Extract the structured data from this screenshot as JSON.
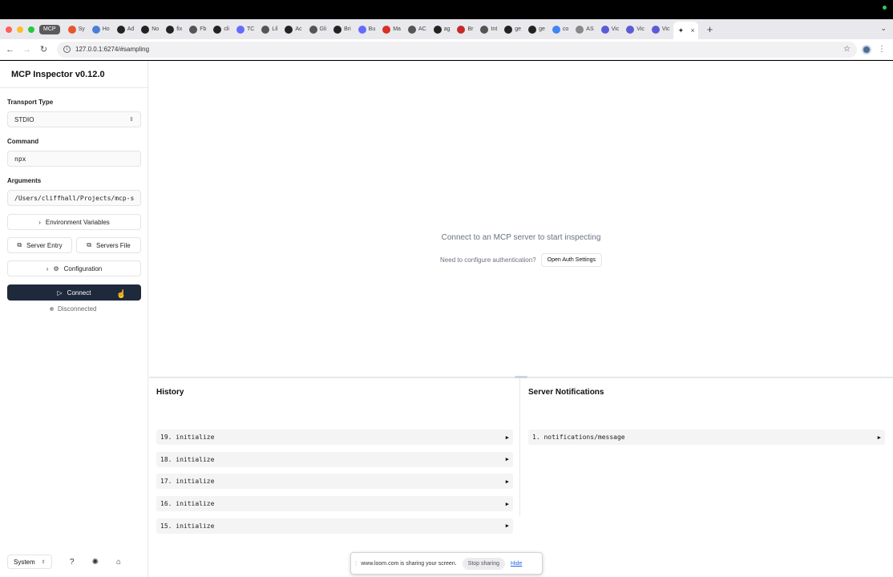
{
  "browser": {
    "pinned_tab": "MCP",
    "tabs": [
      {
        "label": "Sy",
        "icon": "sync-icon",
        "color": "#e4572e"
      },
      {
        "label": "Ho",
        "icon": "home-icon",
        "color": "#4a7fd6"
      },
      {
        "label": "Ad",
        "icon": "github-icon",
        "color": "#222222"
      },
      {
        "label": "No",
        "icon": "github-icon",
        "color": "#222222"
      },
      {
        "label": "fix",
        "icon": "github-icon",
        "color": "#222222"
      },
      {
        "label": "Fb",
        "icon": "file-icon",
        "color": "#555555"
      },
      {
        "label": "cli",
        "icon": "github-icon",
        "color": "#222222"
      },
      {
        "label": "TC",
        "icon": "vite-icon",
        "color": "#646cff"
      },
      {
        "label": "Lil",
        "icon": "lil-icon",
        "color": "#555555"
      },
      {
        "label": "Ac",
        "icon": "github-icon",
        "color": "#222222"
      },
      {
        "label": "Gli",
        "icon": "doc-icon",
        "color": "#555555"
      },
      {
        "label": "Bri",
        "icon": "github-icon",
        "color": "#222222"
      },
      {
        "label": "Bu",
        "icon": "vite-icon",
        "color": "#646cff"
      },
      {
        "label": "Ma",
        "icon": "gmail-icon",
        "color": "#d93025"
      },
      {
        "label": "AC",
        "icon": "chrome-icon",
        "color": "#555555"
      },
      {
        "label": "ag",
        "icon": "github-icon",
        "color": "#222222"
      },
      {
        "label": "Br",
        "icon": "red-icon",
        "color": "#c62828"
      },
      {
        "label": "Int",
        "icon": "pin-icon",
        "color": "#555555"
      },
      {
        "label": "ge",
        "icon": "github-icon",
        "color": "#222222"
      },
      {
        "label": "ge",
        "icon": "github-icon",
        "color": "#222222"
      },
      {
        "label": "co",
        "icon": "google-icon",
        "color": "#4285f4"
      },
      {
        "label": "AS",
        "icon": "gear-icon",
        "color": "#888888"
      },
      {
        "label": "Vic",
        "icon": "react-icon",
        "color": "#5b5bd6"
      },
      {
        "label": "Vic",
        "icon": "react-icon",
        "color": "#5b5bd6"
      },
      {
        "label": "Vic",
        "icon": "react-icon",
        "color": "#5b5bd6"
      }
    ],
    "url": "127.0.0.1:6274/#sampling"
  },
  "sidebar": {
    "title": "MCP Inspector v0.12.0",
    "transport_label": "Transport Type",
    "transport_value": "STDIO",
    "command_label": "Command",
    "command_value": "npx",
    "arguments_label": "Arguments",
    "arguments_value": "/Users/cliffhall/Projects/mcp-s",
    "env_button": "Environment Variables",
    "server_entry_button": "Server Entry",
    "servers_file_button": "Servers File",
    "config_button": "Configuration",
    "connect_button": "Connect",
    "status": "Disconnected",
    "theme": "System"
  },
  "main": {
    "empty_title": "Connect to an MCP server to start inspecting",
    "auth_prompt": "Need to configure authentication?",
    "auth_button": "Open Auth Settings"
  },
  "history": {
    "title": "History",
    "items": [
      "19. initialize",
      "18. initialize",
      "17. initialize",
      "16. initialize",
      "15. initialize"
    ]
  },
  "notifications": {
    "title": "Server Notifications",
    "items": [
      "1. notifications/message"
    ]
  },
  "loom": {
    "message": "www.loom.com is sharing your screen.",
    "stop": "Stop sharing",
    "hide": "Hide"
  },
  "colors": {
    "connect_bg": "#1e293b",
    "accent_link": "#2563eb"
  }
}
